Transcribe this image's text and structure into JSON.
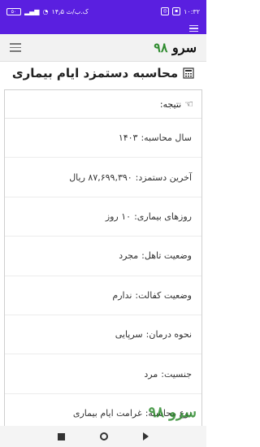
{
  "status_bar": {
    "time": "۱۰:۳۲",
    "speed": "۱۴٫۵ ک.ب/ث",
    "battery": "۵۰"
  },
  "header": {
    "logo_text": "سرو",
    "logo_number": "۹۸"
  },
  "page_title": "محاسبه دستمزد ایام بیماری",
  "result": {
    "heading": "نتیجه:",
    "rows": [
      {
        "label": "سال محاسبه:",
        "value": "۱۴۰۳"
      },
      {
        "label": "آخرین دستمزد:",
        "value": "۸۷,۶۹۹,۳۹۰ ریال"
      },
      {
        "label": "روزهای بیماری:",
        "value": "۱۰ روز"
      },
      {
        "label": "وضعیت تاهل:",
        "value": "مجرد"
      },
      {
        "label": "وضعیت کفالت:",
        "value": "ندارم"
      },
      {
        "label": "نحوه درمان:",
        "value": "سرپایی"
      },
      {
        "label": "جنسیت:",
        "value": "مرد"
      },
      {
        "label": "نوع محاسبه:",
        "value": "غرامت ایام بیماری"
      }
    ]
  },
  "watermark": "سرو ۹۸",
  "icons": {
    "page_title": "calculator-icon",
    "result": "pointing-hand-icon",
    "menu": "hamburger-menu-icon"
  },
  "colors": {
    "status_bar": "#5a1fe0",
    "logo_number": "#2e8b2e"
  }
}
